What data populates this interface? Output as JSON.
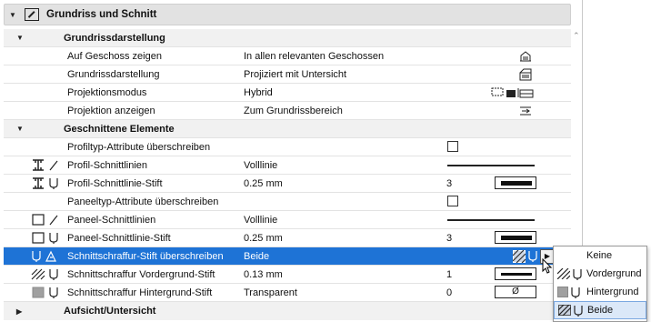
{
  "section": {
    "title": "Grundriss und Schnitt"
  },
  "groups": {
    "grundriss": "Grundrissdarstellung",
    "geschnitten": "Geschnittene Elemente",
    "aufsicht": "Aufsicht/Untersicht"
  },
  "rows": {
    "r1": {
      "label": "Auf Geschoss zeigen",
      "value": "In allen relevanten Geschossen"
    },
    "r2": {
      "label": "Grundrissdarstellung",
      "value": "Projiziert mit Untersicht"
    },
    "r3": {
      "label": "Projektionsmodus",
      "value": "Hybrid"
    },
    "r4": {
      "label": "Projektion anzeigen",
      "value": "Zum Grundrissbereich"
    },
    "r5": {
      "label": "Profiltyp-Attribute überschreiben"
    },
    "r6": {
      "label": "Profil-Schnittlinien",
      "value": "Volllinie"
    },
    "r7": {
      "label": "Profil-Schnittlinie-Stift",
      "value": "0.25 mm",
      "pen": "3"
    },
    "r8": {
      "label": "Paneeltyp-Attribute überschreiben"
    },
    "r9": {
      "label": "Paneel-Schnittlinien",
      "value": "Volllinie"
    },
    "r10": {
      "label": "Paneel-Schnittlinie-Stift",
      "value": "0.25 mm",
      "pen": "3"
    },
    "r11": {
      "label": "Schnittschraffur-Stift überschreiben",
      "value": "Beide"
    },
    "r12": {
      "label": "Schnittschraffur Vordergrund-Stift",
      "value": "0.13 mm",
      "pen": "1"
    },
    "r13": {
      "label": "Schnittschraffur Hintergrund-Stift",
      "value": "Transparent",
      "pen": "0",
      "pen_symbol": "Ø"
    }
  },
  "dropdown": {
    "options": [
      "Keine",
      "Vordergrund",
      "Hintergrund",
      "Beide"
    ],
    "selected": "Beide"
  },
  "colors": {
    "selection": "#1e73d6",
    "header_bg": "#e2e2e2",
    "group_bg": "#f1f1f1"
  },
  "icons": [
    "triangle-down-icon",
    "section-plan-icon",
    "story-icon",
    "floor-plan-display-icon",
    "projection-mode-icon",
    "projection-icon",
    "profile-icon",
    "line-icon",
    "pen-icon",
    "hatch-icon",
    "square-icon",
    "dropdown-arrow-icon",
    "mouse-cursor-icon"
  ]
}
